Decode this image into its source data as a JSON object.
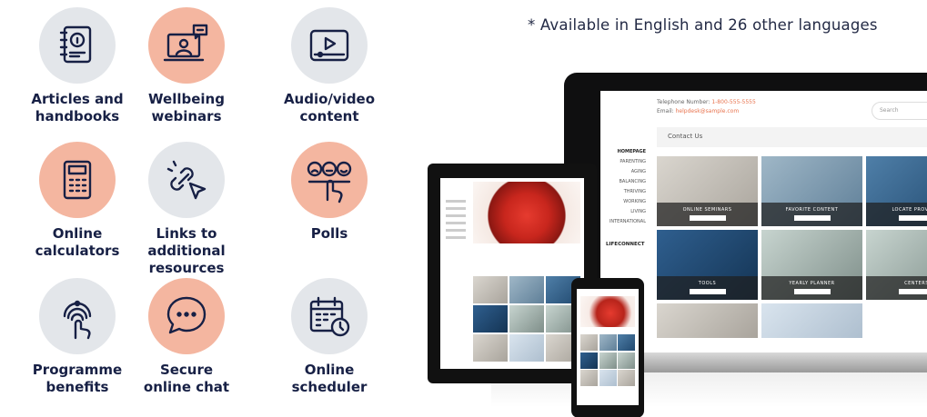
{
  "caption": "* Available in English and 26 other languages",
  "features": [
    {
      "lines": [
        "Articles and",
        "handbooks"
      ],
      "icon": "handbook-icon",
      "style": "grey"
    },
    {
      "lines": [
        "Wellbeing",
        "webinars"
      ],
      "icon": "webinar-icon",
      "style": "peach"
    },
    {
      "lines": [
        "Audio/video",
        "content"
      ],
      "icon": "video-player-icon",
      "style": "grey"
    },
    {
      "lines": [
        "Online",
        "calculators"
      ],
      "icon": "calculator-icon",
      "style": "peach"
    },
    {
      "lines": [
        "Links to",
        "additional",
        "resources"
      ],
      "icon": "link-cursor-icon",
      "style": "grey"
    },
    {
      "lines": [
        "Polls"
      ],
      "icon": "poll-faces-icon",
      "style": "peach"
    },
    {
      "lines": [
        "Programme",
        "benefits"
      ],
      "icon": "fingerprint-touch-icon",
      "style": "grey"
    },
    {
      "lines": [
        "Secure",
        "online chat"
      ],
      "icon": "chat-bubble-icon",
      "style": "peach"
    },
    {
      "lines": [
        "Online",
        "scheduler"
      ],
      "icon": "calendar-clock-icon",
      "style": "grey"
    }
  ],
  "laptop": {
    "telephone_label": "Telephone Number:",
    "telephone_value": "1-800-555-5555",
    "email_label": "Email:",
    "email_value": "helpdesk@sample.com",
    "search_placeholder": "Search",
    "contact": "Contact Us",
    "nav": [
      "HOMEPAGE",
      "PARENTING",
      "AGING",
      "BALANCING",
      "THRIVING",
      "WORKING",
      "LIVING",
      "INTERNATIONAL"
    ],
    "logo": "LIFECONNECT",
    "tiles": [
      {
        "title": "ONLINE SEMINARS",
        "bg": "bg-light"
      },
      {
        "title": "FAVORITE CONTENT",
        "bg": "bg-smile"
      },
      {
        "title": "LOCATE PROVIDER",
        "bg": "bg-blue"
      },
      {
        "title": "TOOLS",
        "bg": "bg-keys"
      },
      {
        "title": "YEARLY PLANNER",
        "bg": "bg-pin"
      },
      {
        "title": "CENTERS",
        "bg": "bg-pin"
      },
      {
        "title": "",
        "bg": "bg-light"
      },
      {
        "title": "",
        "bg": "bg-stars"
      }
    ]
  },
  "colors": {
    "navy": "#172045",
    "peach": "#f4b6a0",
    "grey": "#e3e6ea",
    "accent": "#e8744f"
  }
}
